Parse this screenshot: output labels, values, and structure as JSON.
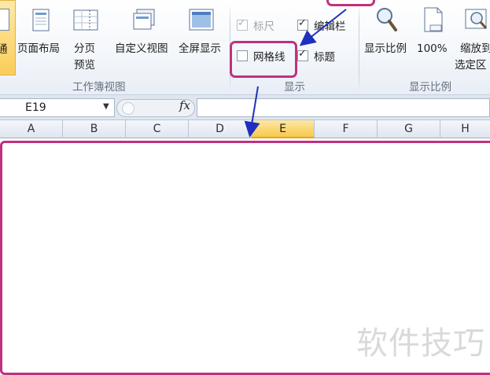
{
  "ribbon": {
    "buttons": {
      "normal": "通",
      "page_layout": "页面布局",
      "page_break_line1": "分页",
      "page_break_line2": "预览",
      "custom_views": "自定义视图",
      "full_screen": "全屏显示",
      "zoom": "显示比例",
      "zoom_100": "100%",
      "zoom_selection_line1": "缩放到",
      "zoom_selection_line2": "选定区"
    },
    "checkboxes": {
      "ruler": {
        "label": "标尺",
        "checked": true,
        "disabled": true
      },
      "formula_bar": {
        "label": "编辑栏",
        "checked": true
      },
      "gridlines": {
        "label": "网格线",
        "checked": false
      },
      "headings": {
        "label": "标题",
        "checked": true
      }
    },
    "groups": {
      "workbook_views": "工作簿视图",
      "show": "显示",
      "zoom": "显示比例"
    }
  },
  "formula_bar": {
    "name_box": "E19",
    "fx_label": "fx",
    "value": ""
  },
  "columns": [
    "A",
    "B",
    "C",
    "D",
    "E",
    "F",
    "G",
    "H"
  ],
  "active_column": "E",
  "annotation_color": "#c0317e",
  "arrow_color": "#1f2fbf",
  "watermark": "软件技巧"
}
